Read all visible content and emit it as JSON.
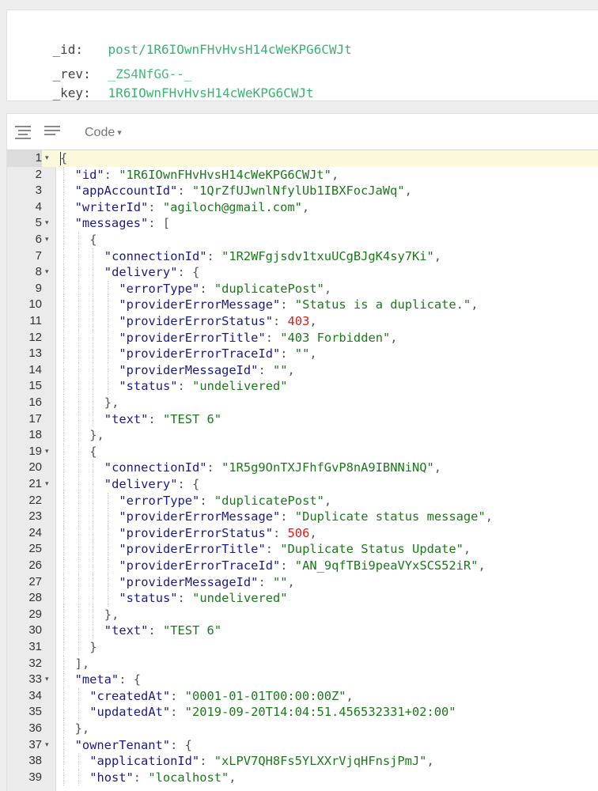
{
  "meta": {
    "id_label": "_id:",
    "id_value": "post/1R6IOwnFHvHvsH14cWeKPG6CWJt",
    "rev_label": "_rev:",
    "rev_value": "_ZS4NfGG--_",
    "key_label": "_key:",
    "key_value": "1R6IOwnFHvHvsH14cWeKPG6CWJt"
  },
  "toolbar": {
    "format_icon": "format-align-icon",
    "compact_icon": "compact-lines-icon",
    "mode_label": "Code",
    "mode_caret": "▾"
  },
  "editor": {
    "active_line": 1,
    "lines": [
      {
        "n": "1",
        "indent": 0,
        "fold": true,
        "t": [
          [
            "p",
            "{"
          ]
        ]
      },
      {
        "n": "2",
        "indent": 1,
        "t": [
          [
            "k",
            "\"id\""
          ],
          [
            "p",
            ": "
          ],
          [
            "s",
            "\"1R6IOwnFHvHvsH14cWeKPG6CWJt\""
          ],
          [
            "p",
            ","
          ]
        ]
      },
      {
        "n": "3",
        "indent": 1,
        "t": [
          [
            "k",
            "\"appAccountId\""
          ],
          [
            "p",
            ": "
          ],
          [
            "s",
            "\"1QrZfUJwnlNfylUb1IBXFocJaWq\""
          ],
          [
            "p",
            ","
          ]
        ]
      },
      {
        "n": "4",
        "indent": 1,
        "t": [
          [
            "k",
            "\"writerId\""
          ],
          [
            "p",
            ": "
          ],
          [
            "s",
            "\"agiloch@gmail.com\""
          ],
          [
            "p",
            ","
          ]
        ]
      },
      {
        "n": "5",
        "indent": 1,
        "fold": true,
        "t": [
          [
            "k",
            "\"messages\""
          ],
          [
            "p",
            ": ["
          ]
        ]
      },
      {
        "n": "6",
        "indent": 2,
        "fold": true,
        "t": [
          [
            "p",
            "{"
          ]
        ]
      },
      {
        "n": "7",
        "indent": 3,
        "t": [
          [
            "k",
            "\"connectionId\""
          ],
          [
            "p",
            ": "
          ],
          [
            "s",
            "\"1R2WFgjsdv1txuUCgBJgK4sy7Ki\""
          ],
          [
            "p",
            ","
          ]
        ]
      },
      {
        "n": "8",
        "indent": 3,
        "fold": true,
        "t": [
          [
            "k",
            "\"delivery\""
          ],
          [
            "p",
            ": {"
          ]
        ]
      },
      {
        "n": "9",
        "indent": 4,
        "t": [
          [
            "k",
            "\"errorType\""
          ],
          [
            "p",
            ": "
          ],
          [
            "s",
            "\"duplicatePost\""
          ],
          [
            "p",
            ","
          ]
        ]
      },
      {
        "n": "10",
        "indent": 4,
        "t": [
          [
            "k",
            "\"providerErrorMessage\""
          ],
          [
            "p",
            ": "
          ],
          [
            "s",
            "\"Status is a duplicate.\""
          ],
          [
            "p",
            ","
          ]
        ]
      },
      {
        "n": "11",
        "indent": 4,
        "t": [
          [
            "k",
            "\"providerErrorStatus\""
          ],
          [
            "p",
            ": "
          ],
          [
            "n",
            "403"
          ],
          [
            "p",
            ","
          ]
        ]
      },
      {
        "n": "12",
        "indent": 4,
        "t": [
          [
            "k",
            "\"providerErrorTitle\""
          ],
          [
            "p",
            ": "
          ],
          [
            "s",
            "\"403 Forbidden\""
          ],
          [
            "p",
            ","
          ]
        ]
      },
      {
        "n": "13",
        "indent": 4,
        "t": [
          [
            "k",
            "\"providerErrorTraceId\""
          ],
          [
            "p",
            ": "
          ],
          [
            "s",
            "\"\""
          ],
          [
            "p",
            ","
          ]
        ]
      },
      {
        "n": "14",
        "indent": 4,
        "t": [
          [
            "k",
            "\"providerMessageId\""
          ],
          [
            "p",
            ": "
          ],
          [
            "s",
            "\"\""
          ],
          [
            "p",
            ","
          ]
        ]
      },
      {
        "n": "15",
        "indent": 4,
        "t": [
          [
            "k",
            "\"status\""
          ],
          [
            "p",
            ": "
          ],
          [
            "s",
            "\"undelivered\""
          ]
        ]
      },
      {
        "n": "16",
        "indent": 3,
        "t": [
          [
            "p",
            "},"
          ]
        ]
      },
      {
        "n": "17",
        "indent": 3,
        "t": [
          [
            "k",
            "\"text\""
          ],
          [
            "p",
            ": "
          ],
          [
            "s",
            "\"TEST 6\""
          ]
        ]
      },
      {
        "n": "18",
        "indent": 2,
        "t": [
          [
            "p",
            "},"
          ]
        ]
      },
      {
        "n": "19",
        "indent": 2,
        "fold": true,
        "t": [
          [
            "p",
            "{"
          ]
        ]
      },
      {
        "n": "20",
        "indent": 3,
        "t": [
          [
            "k",
            "\"connectionId\""
          ],
          [
            "p",
            ": "
          ],
          [
            "s",
            "\"1R5g9OnTXJFhfGvP8nA9IBNNiNQ\""
          ],
          [
            "p",
            ","
          ]
        ]
      },
      {
        "n": "21",
        "indent": 3,
        "fold": true,
        "t": [
          [
            "k",
            "\"delivery\""
          ],
          [
            "p",
            ": {"
          ]
        ]
      },
      {
        "n": "22",
        "indent": 4,
        "t": [
          [
            "k",
            "\"errorType\""
          ],
          [
            "p",
            ": "
          ],
          [
            "s",
            "\"duplicatePost\""
          ],
          [
            "p",
            ","
          ]
        ]
      },
      {
        "n": "23",
        "indent": 4,
        "t": [
          [
            "k",
            "\"providerErrorMessage\""
          ],
          [
            "p",
            ": "
          ],
          [
            "s",
            "\"Duplicate status message\""
          ],
          [
            "p",
            ","
          ]
        ]
      },
      {
        "n": "24",
        "indent": 4,
        "t": [
          [
            "k",
            "\"providerErrorStatus\""
          ],
          [
            "p",
            ": "
          ],
          [
            "n",
            "506"
          ],
          [
            "p",
            ","
          ]
        ]
      },
      {
        "n": "25",
        "indent": 4,
        "t": [
          [
            "k",
            "\"providerErrorTitle\""
          ],
          [
            "p",
            ": "
          ],
          [
            "s",
            "\"Duplicate Status Update\""
          ],
          [
            "p",
            ","
          ]
        ]
      },
      {
        "n": "26",
        "indent": 4,
        "t": [
          [
            "k",
            "\"providerErrorTraceId\""
          ],
          [
            "p",
            ": "
          ],
          [
            "s",
            "\"AN_9qfTBi9peaVYxSCS52iR\""
          ],
          [
            "p",
            ","
          ]
        ]
      },
      {
        "n": "27",
        "indent": 4,
        "t": [
          [
            "k",
            "\"providerMessageId\""
          ],
          [
            "p",
            ": "
          ],
          [
            "s",
            "\"\""
          ],
          [
            "p",
            ","
          ]
        ]
      },
      {
        "n": "28",
        "indent": 4,
        "t": [
          [
            "k",
            "\"status\""
          ],
          [
            "p",
            ": "
          ],
          [
            "s",
            "\"undelivered\""
          ]
        ]
      },
      {
        "n": "29",
        "indent": 3,
        "t": [
          [
            "p",
            "},"
          ]
        ]
      },
      {
        "n": "30",
        "indent": 3,
        "t": [
          [
            "k",
            "\"text\""
          ],
          [
            "p",
            ": "
          ],
          [
            "s",
            "\"TEST 6\""
          ]
        ]
      },
      {
        "n": "31",
        "indent": 2,
        "t": [
          [
            "p",
            "}"
          ]
        ]
      },
      {
        "n": "32",
        "indent": 1,
        "t": [
          [
            "p",
            "],"
          ]
        ]
      },
      {
        "n": "33",
        "indent": 1,
        "fold": true,
        "t": [
          [
            "k",
            "\"meta\""
          ],
          [
            "p",
            ": {"
          ]
        ]
      },
      {
        "n": "34",
        "indent": 2,
        "t": [
          [
            "k",
            "\"createdAt\""
          ],
          [
            "p",
            ": "
          ],
          [
            "s",
            "\"0001-01-01T00:00:00Z\""
          ],
          [
            "p",
            ","
          ]
        ]
      },
      {
        "n": "35",
        "indent": 2,
        "t": [
          [
            "k",
            "\"updatedAt\""
          ],
          [
            "p",
            ": "
          ],
          [
            "s",
            "\"2019-09-20T14:04:51.456532331+02:00\""
          ]
        ]
      },
      {
        "n": "36",
        "indent": 1,
        "t": [
          [
            "p",
            "},"
          ]
        ]
      },
      {
        "n": "37",
        "indent": 1,
        "fold": true,
        "t": [
          [
            "k",
            "\"ownerTenant\""
          ],
          [
            "p",
            ": {"
          ]
        ]
      },
      {
        "n": "38",
        "indent": 2,
        "t": [
          [
            "k",
            "\"applicationId\""
          ],
          [
            "p",
            ": "
          ],
          [
            "s",
            "\"xLPV7QH8Fs5YLXXrVjqHFnsjPmJ\""
          ],
          [
            "p",
            ","
          ]
        ]
      },
      {
        "n": "39",
        "indent": 2,
        "t": [
          [
            "k",
            "\"host\""
          ],
          [
            "p",
            ": "
          ],
          [
            "s",
            "\"localhost\""
          ],
          [
            "p",
            ","
          ]
        ]
      }
    ]
  }
}
